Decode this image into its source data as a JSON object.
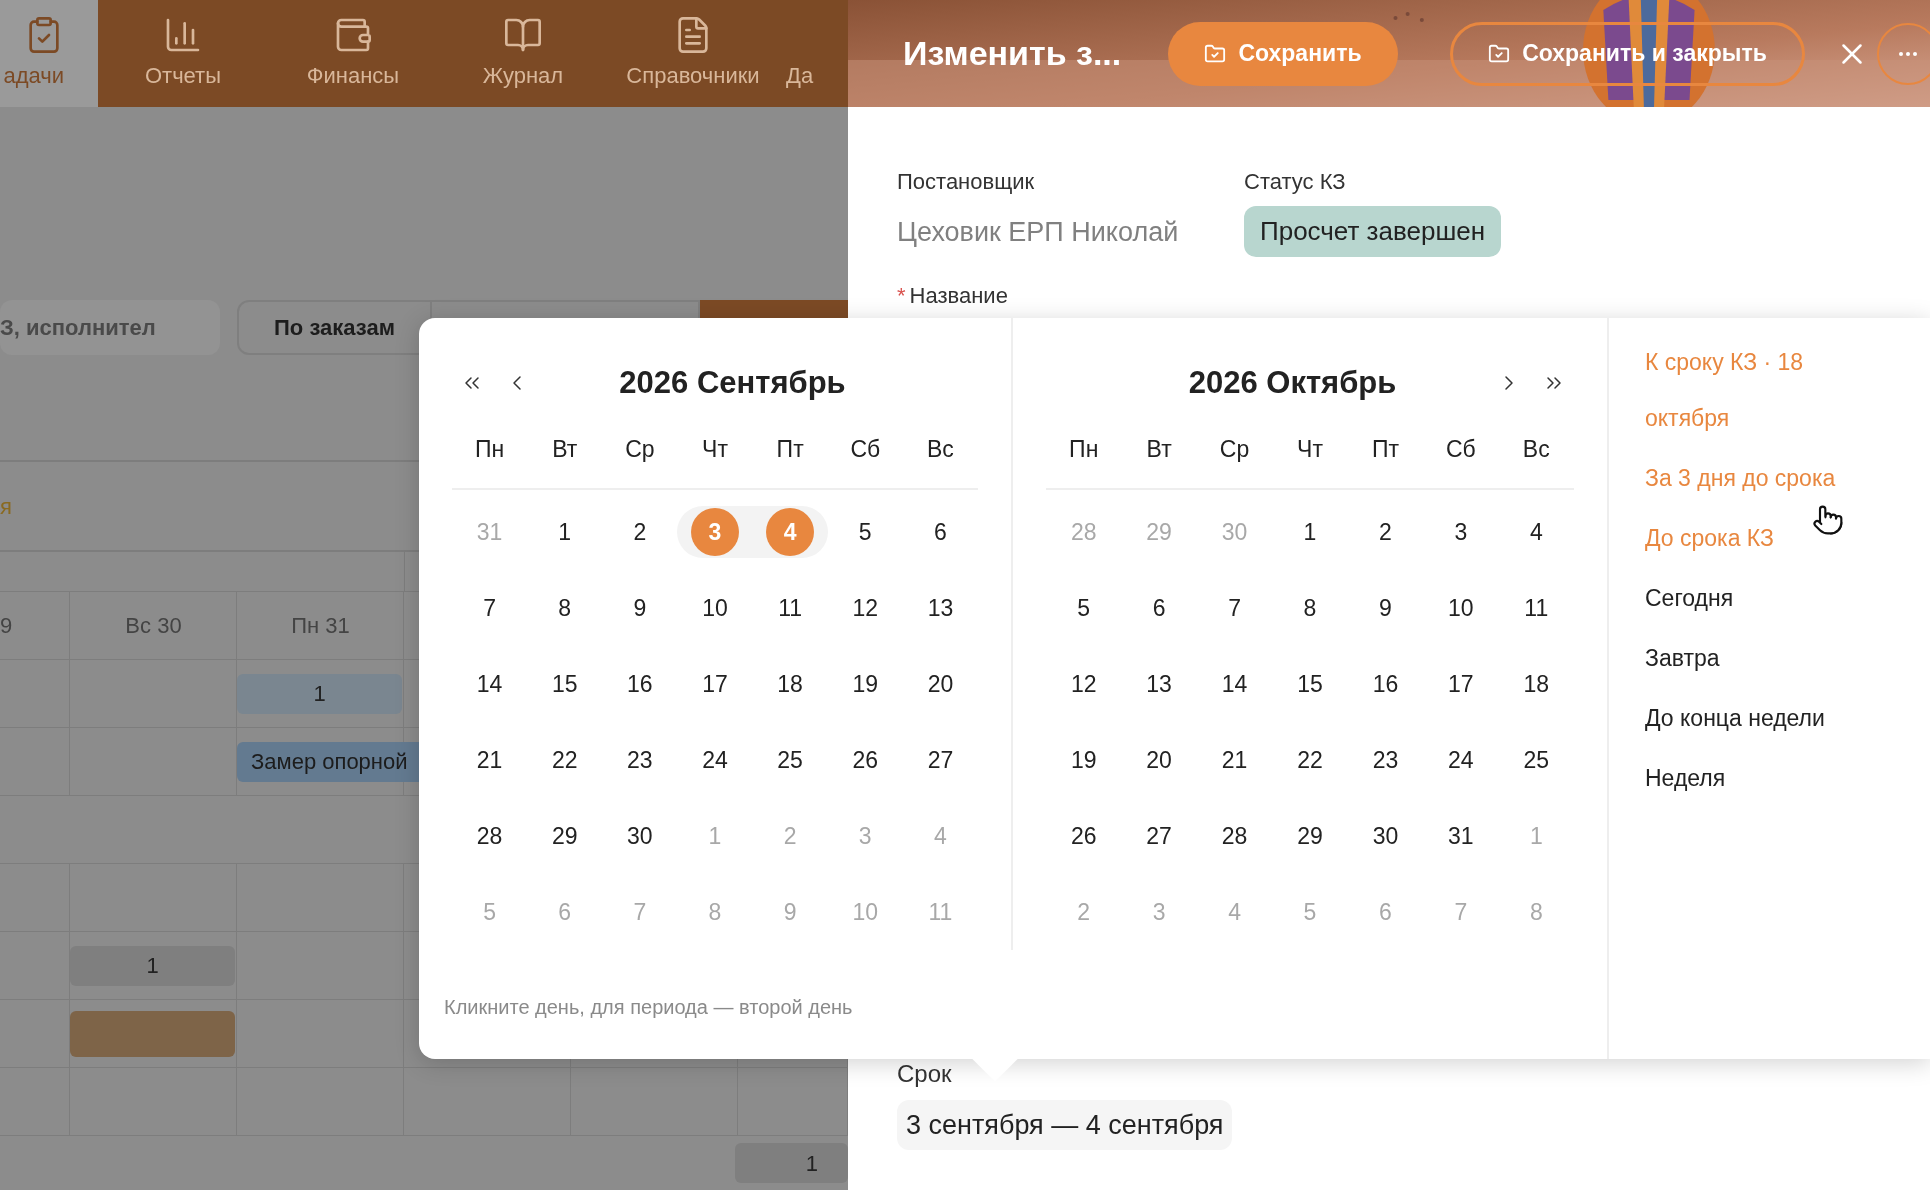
{
  "nav": {
    "items": [
      {
        "label": "адачи",
        "kind": "tasks",
        "selected": true
      },
      {
        "label": "Отчеты",
        "kind": "reports",
        "selected": false
      },
      {
        "label": "Финансы",
        "kind": "finance",
        "selected": false
      },
      {
        "label": "Журнал",
        "kind": "journal",
        "selected": false
      },
      {
        "label": "Справочники",
        "kind": "refs",
        "selected": false
      },
      {
        "label": "Да",
        "kind": "none",
        "selected": false
      }
    ]
  },
  "toolbar": {
    "search": {
      "placeholder": "З, исполнител"
    },
    "filter_button": "По заказам"
  },
  "section_label": "я",
  "schedule": {
    "columns": [
      "9",
      "Вс 30",
      "Пн 31"
    ],
    "bars": [
      {
        "text": "1",
        "kind": "light"
      },
      {
        "text": "Замер опорной",
        "kind": "blue"
      },
      {
        "text": "1",
        "kind": "grey"
      },
      {
        "kind": "brown"
      },
      {
        "text": "1",
        "kind": "grey"
      }
    ]
  },
  "editor": {
    "title": "Изменить з...",
    "buttons": [
      {
        "label": "Сохранить",
        "kind": "primary"
      },
      {
        "label": "Сохранить и закрыть",
        "kind": "outline"
      }
    ],
    "fields": {
      "assigner_label": "Постановщик",
      "assigner": "Цеховик ЕРП Николай",
      "status_label": "Статус КЗ",
      "status": "Просчет завершен",
      "name_label": "Название",
      "required_mark": "*",
      "deadline_label": "Срок",
      "deadline": "3 сентября — 4 сентября"
    }
  },
  "date_picker": {
    "months": [
      {
        "title": "2026 Сентябрь",
        "weekdays": [
          "Пн",
          "Вт",
          "Ср",
          "Чт",
          "Пт",
          "Сб",
          "Вс"
        ],
        "weeks": [
          [
            {
              "label": "31",
              "outside": true,
              "selected": false
            },
            {
              "label": "1",
              "outside": false,
              "selected": false
            },
            {
              "label": "2",
              "outside": false,
              "selected": false
            },
            {
              "label": "3",
              "outside": false,
              "selected": true
            },
            {
              "label": "4",
              "outside": false,
              "selected": true
            },
            {
              "label": "5",
              "outside": false,
              "selected": false
            },
            {
              "label": "6",
              "outside": false,
              "selected": false
            }
          ],
          [
            {
              "label": "7",
              "outside": false,
              "selected": false
            },
            {
              "label": "8",
              "outside": false,
              "selected": false
            },
            {
              "label": "9",
              "outside": false,
              "selected": false
            },
            {
              "label": "10",
              "outside": false,
              "selected": false
            },
            {
              "label": "11",
              "outside": false,
              "selected": false
            },
            {
              "label": "12",
              "outside": false,
              "selected": false
            },
            {
              "label": "13",
              "outside": false,
              "selected": false
            }
          ],
          [
            {
              "label": "14",
              "outside": false,
              "selected": false
            },
            {
              "label": "15",
              "outside": false,
              "selected": false
            },
            {
              "label": "16",
              "outside": false,
              "selected": false
            },
            {
              "label": "17",
              "outside": false,
              "selected": false
            },
            {
              "label": "18",
              "outside": false,
              "selected": false
            },
            {
              "label": "19",
              "outside": false,
              "selected": false
            },
            {
              "label": "20",
              "outside": false,
              "selected": false
            }
          ],
          [
            {
              "label": "21",
              "outside": false,
              "selected": false
            },
            {
              "label": "22",
              "outside": false,
              "selected": false
            },
            {
              "label": "23",
              "outside": false,
              "selected": false
            },
            {
              "label": "24",
              "outside": false,
              "selected": false
            },
            {
              "label": "25",
              "outside": false,
              "selected": false
            },
            {
              "label": "26",
              "outside": false,
              "selected": false
            },
            {
              "label": "27",
              "outside": false,
              "selected": false
            }
          ],
          [
            {
              "label": "28",
              "outside": false,
              "selected": false
            },
            {
              "label": "29",
              "outside": false,
              "selected": false
            },
            {
              "label": "30",
              "outside": false,
              "selected": false
            },
            {
              "label": "1",
              "outside": true,
              "selected": false
            },
            {
              "label": "2",
              "outside": true,
              "selected": false
            },
            {
              "label": "3",
              "outside": true,
              "selected": false
            },
            {
              "label": "4",
              "outside": true,
              "selected": false
            }
          ],
          [
            {
              "label": "5",
              "outside": true,
              "selected": false
            },
            {
              "label": "6",
              "outside": true,
              "selected": false
            },
            {
              "label": "7",
              "outside": true,
              "selected": false
            },
            {
              "label": "8",
              "outside": true,
              "selected": false
            },
            {
              "label": "9",
              "outside": true,
              "selected": false
            },
            {
              "label": "10",
              "outside": true,
              "selected": false
            },
            {
              "label": "11",
              "outside": true,
              "selected": false
            }
          ]
        ]
      },
      {
        "title": "2026 Октябрь",
        "weekdays": [
          "Пн",
          "Вт",
          "Ср",
          "Чт",
          "Пт",
          "Сб",
          "Вс"
        ],
        "weeks": [
          [
            {
              "label": "28",
              "outside": true,
              "selected": false
            },
            {
              "label": "29",
              "outside": true,
              "selected": false
            },
            {
              "label": "30",
              "outside": true,
              "selected": false
            },
            {
              "label": "1",
              "outside": false,
              "selected": false
            },
            {
              "label": "2",
              "outside": false,
              "selected": false
            },
            {
              "label": "3",
              "outside": false,
              "selected": false
            },
            {
              "label": "4",
              "outside": false,
              "selected": false
            }
          ],
          [
            {
              "label": "5",
              "outside": false,
              "selected": false
            },
            {
              "label": "6",
              "outside": false,
              "selected": false
            },
            {
              "label": "7",
              "outside": false,
              "selected": false
            },
            {
              "label": "8",
              "outside": false,
              "selected": false
            },
            {
              "label": "9",
              "outside": false,
              "selected": false
            },
            {
              "label": "10",
              "outside": false,
              "selected": false
            },
            {
              "label": "11",
              "outside": false,
              "selected": false
            }
          ],
          [
            {
              "label": "12",
              "outside": false,
              "selected": false
            },
            {
              "label": "13",
              "outside": false,
              "selected": false
            },
            {
              "label": "14",
              "outside": false,
              "selected": false
            },
            {
              "label": "15",
              "outside": false,
              "selected": false
            },
            {
              "label": "16",
              "outside": false,
              "selected": false
            },
            {
              "label": "17",
              "outside": false,
              "selected": false
            },
            {
              "label": "18",
              "outside": false,
              "selected": false
            }
          ],
          [
            {
              "label": "19",
              "outside": false,
              "selected": false
            },
            {
              "label": "20",
              "outside": false,
              "selected": false
            },
            {
              "label": "21",
              "outside": false,
              "selected": false
            },
            {
              "label": "22",
              "outside": false,
              "selected": false
            },
            {
              "label": "23",
              "outside": false,
              "selected": false
            },
            {
              "label": "24",
              "outside": false,
              "selected": false
            },
            {
              "label": "25",
              "outside": false,
              "selected": false
            }
          ],
          [
            {
              "label": "26",
              "outside": false,
              "selected": false
            },
            {
              "label": "27",
              "outside": false,
              "selected": false
            },
            {
              "label": "28",
              "outside": false,
              "selected": false
            },
            {
              "label": "29",
              "outside": false,
              "selected": false
            },
            {
              "label": "30",
              "outside": false,
              "selected": false
            },
            {
              "label": "31",
              "outside": false,
              "selected": false
            },
            {
              "label": "1",
              "outside": true,
              "selected": false
            }
          ],
          [
            {
              "label": "2",
              "outside": true,
              "selected": false
            },
            {
              "label": "3",
              "outside": true,
              "selected": false
            },
            {
              "label": "4",
              "outside": true,
              "selected": false
            },
            {
              "label": "5",
              "outside": true,
              "selected": false
            },
            {
              "label": "6",
              "outside": true,
              "selected": false
            },
            {
              "label": "7",
              "outside": true,
              "selected": false
            },
            {
              "label": "8",
              "outside": true,
              "selected": false
            }
          ]
        ]
      }
    ],
    "hint": "Кликните день, для периода — второй день",
    "presets": [
      {
        "label": "К сроку КЗ · 18 октября",
        "kind": "deadline"
      },
      {
        "label": "За 3 дня до срока",
        "kind": "deadline"
      },
      {
        "label": "До срока КЗ",
        "kind": "deadline"
      },
      {
        "label": "Сегодня",
        "kind": "plain"
      },
      {
        "label": "Завтра",
        "kind": "plain"
      },
      {
        "label": "До конца недели",
        "kind": "plain"
      },
      {
        "label": "Неделя",
        "kind": "plain"
      }
    ]
  }
}
